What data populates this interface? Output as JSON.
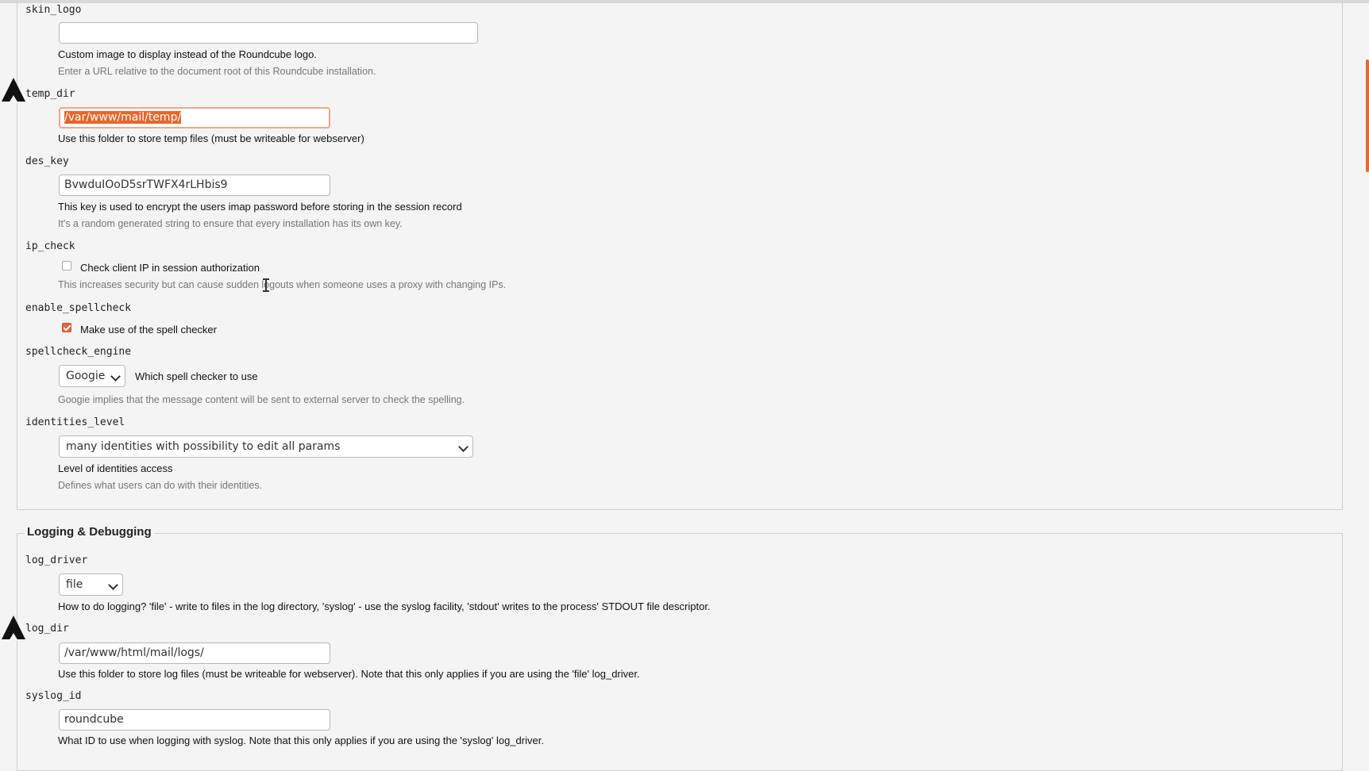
{
  "colors": {
    "accent": "#e06a3a",
    "background": "#f4f4f4"
  },
  "general": {
    "skin_logo": {
      "name": "skin_logo",
      "value": "",
      "desc": "Custom image to display instead of the Roundcube logo.",
      "hint": "Enter a URL relative to the document root of this Roundcube installation."
    },
    "temp_dir": {
      "name": "temp_dir",
      "value": "/var/www/mail/temp/",
      "desc": "Use this folder to store temp files (must be writeable for webserver)"
    },
    "des_key": {
      "name": "des_key",
      "value": "BvwduIOoD5srTWFX4rLHbis9",
      "desc": "This key is used to encrypt the users imap password before storing in the session record",
      "hint": "It's a random generated string to ensure that every installation has its own key."
    },
    "ip_check": {
      "name": "ip_check",
      "checked": false,
      "label": "Check client IP in session authorization",
      "hint": "This increases security but can cause sudden logouts when someone uses a proxy with changing IPs."
    },
    "enable_spellcheck": {
      "name": "enable_spellcheck",
      "checked": true,
      "label": "Make use of the spell checker"
    },
    "spellcheck_engine": {
      "name": "spellcheck_engine",
      "selected": "Googie",
      "desc": "Which spell checker to use",
      "hint": "Googie implies that the message content will be sent to external server to check the spelling."
    },
    "identities_level": {
      "name": "identities_level",
      "selected": "many identities with possibility to edit all params",
      "desc": "Level of identities access",
      "hint": "Defines what users can do with their identities."
    }
  },
  "logging": {
    "legend": "Logging & Debugging",
    "log_driver": {
      "name": "log_driver",
      "selected": "file",
      "desc": "How to do logging? 'file' - write to files in the log directory, 'syslog' - use the syslog facility, 'stdout' writes to the process' STDOUT file descriptor."
    },
    "log_dir": {
      "name": "log_dir",
      "value": "/var/www/html/mail/logs/",
      "desc": "Use this folder to store log files (must be writeable for webserver). Note that this only applies if you are using the 'file' log_driver."
    },
    "syslog_id": {
      "name": "syslog_id",
      "value": "roundcube",
      "desc": "What ID to use when logging with syslog. Note that this only applies if you are using the 'syslog' log_driver."
    }
  }
}
